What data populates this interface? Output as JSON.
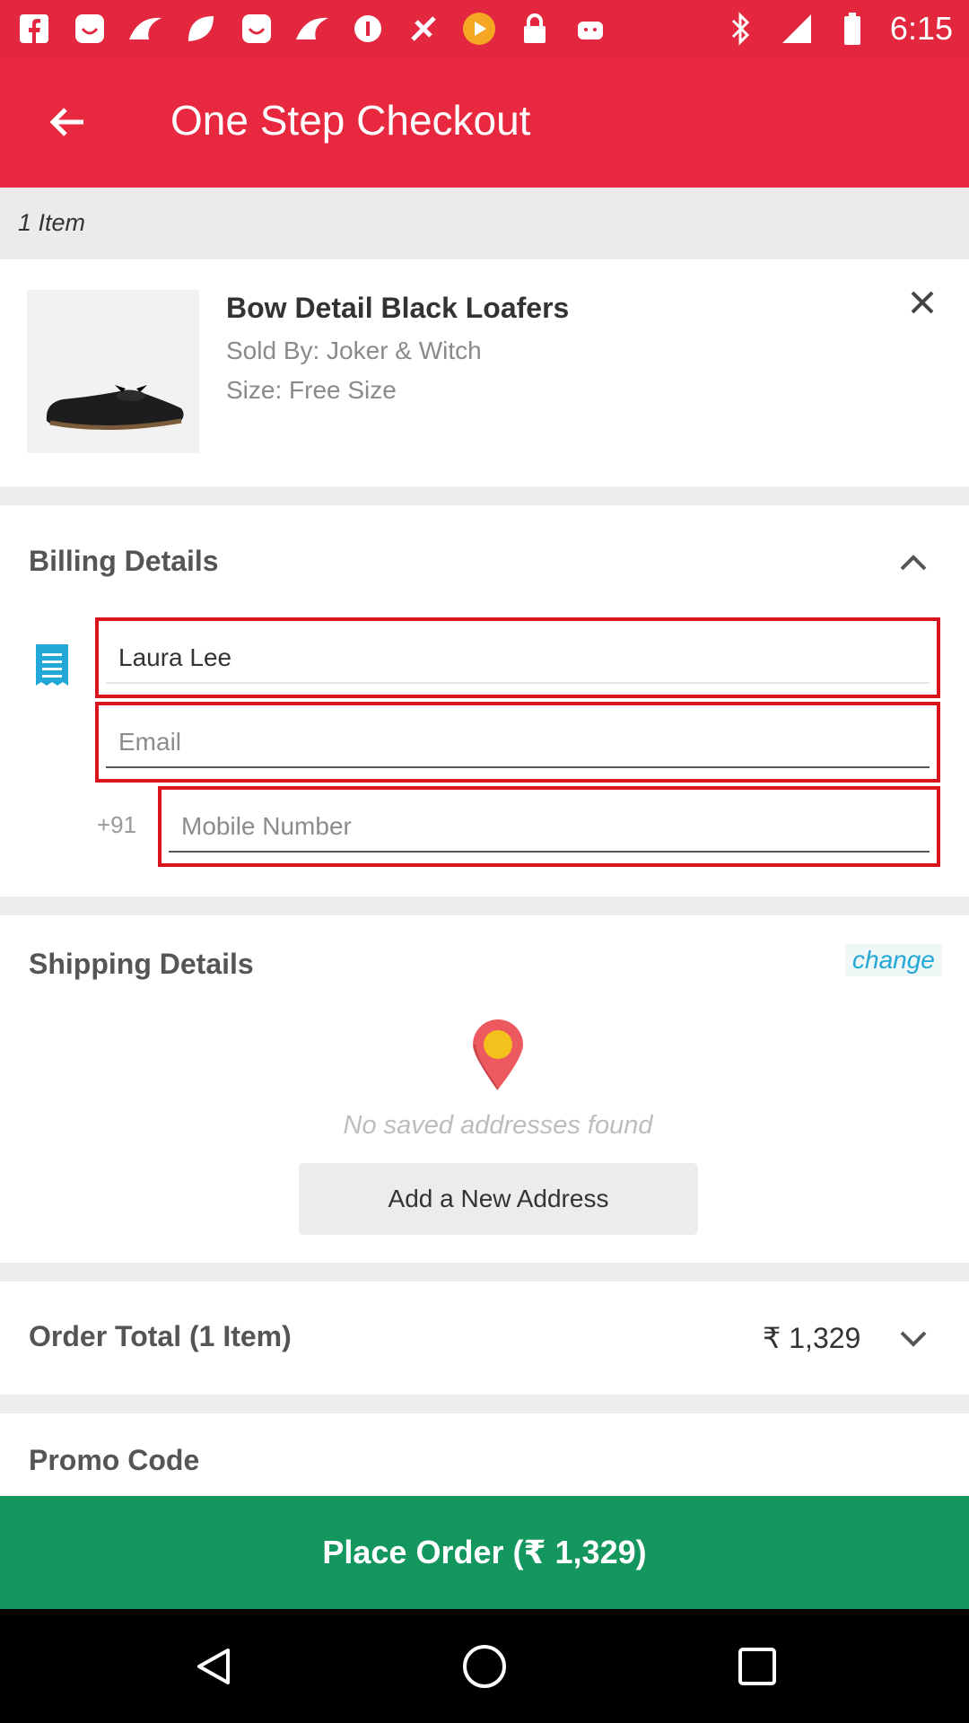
{
  "status_bar": {
    "time": "6:15",
    "left_icons": [
      "facebook-icon",
      "smiley-app-icon",
      "brush-app-icon",
      "leaf-app-icon",
      "smiley-app-icon-2",
      "brush-app-icon-2",
      "pause-icon",
      "satellite-icon",
      "play-badge-icon",
      "lock-icon",
      "android-icon"
    ],
    "right_icons": [
      "bluetooth-icon",
      "signal-icon",
      "battery-icon"
    ]
  },
  "app_bar": {
    "title": "One Step Checkout",
    "back_icon": "arrow-back-icon",
    "color": "#e8283f"
  },
  "cart": {
    "items_count": "1 Item",
    "product": {
      "name": "Bow Detail Black Loafers",
      "seller": "Sold By: Joker & Witch",
      "size": "Size:  Free Size",
      "image_icon": "loafer-shoe-image",
      "remove_icon": "close-icon"
    }
  },
  "billing": {
    "title": "Billing Details",
    "collapse_icon": "chevron-up-icon",
    "receipt_icon": "receipt-icon",
    "name_value": "Laura Lee",
    "email_placeholder": "Email",
    "country_code": "+91",
    "mobile_placeholder": "Mobile Number",
    "error_color": "#d9141e"
  },
  "shipping": {
    "title": "Shipping Details",
    "change_label": "change",
    "pin_icon": "map-pin-icon",
    "empty_message": "No saved addresses found",
    "add_address_label": "Add a New Address"
  },
  "order": {
    "title": "Order Total (1 Item)",
    "amount": "₹ 1,329",
    "expand_icon": "chevron-down-icon"
  },
  "promo": {
    "title": "Promo Code"
  },
  "place_order": {
    "label": "Place Order (₹ 1,329)",
    "color": "#14975e"
  },
  "nav_bar": {
    "icons": [
      "back-triangle-icon",
      "home-circle-icon",
      "recents-square-icon"
    ]
  }
}
